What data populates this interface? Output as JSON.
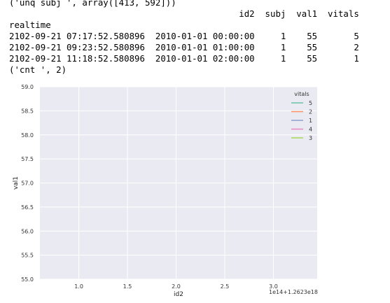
{
  "output": {
    "unq_line": "('unq subj ', array([413, 592]))",
    "table": {
      "index_name": "realtime",
      "columns": [
        "id2",
        "subj",
        "val1",
        "vitals"
      ],
      "rows": [
        {
          "realtime": "2102-09-21 07:17:52.580896",
          "id2": "2010-01-01 00:00:00",
          "subj": "1",
          "val1": "55",
          "vitals": "5"
        },
        {
          "realtime": "2102-09-21 09:23:52.580896",
          "id2": "2010-01-01 01:00:00",
          "subj": "1",
          "val1": "55",
          "vitals": "2"
        },
        {
          "realtime": "2102-09-21 11:18:52.580896",
          "id2": "2010-01-01 02:00:00",
          "subj": "1",
          "val1": "55",
          "vitals": "1"
        }
      ]
    },
    "cnt_line": "('cnt ', 2)"
  },
  "chart_data": {
    "type": "line",
    "xlabel": "id2",
    "ylabel": "val1",
    "x_ticks": [
      "1.0",
      "1.5",
      "2.0",
      "2.5",
      "3.0"
    ],
    "x_offset_label": "1e14+1.2623e18",
    "xlim": [
      0.6,
      3.45
    ],
    "y_ticks": [
      "55.0",
      "55.5",
      "56.0",
      "56.5",
      "57.0",
      "57.5",
      "58.0",
      "58.5",
      "59.0"
    ],
    "ylim": [
      55.0,
      59.0
    ],
    "grid": true,
    "legend": {
      "title": "vitals",
      "placement": "top-right",
      "entries": [
        "5",
        "2",
        "1",
        "4",
        "3"
      ],
      "colors": [
        "#66c2a5",
        "#fc8d62",
        "#8da0cb",
        "#e78ac3",
        "#a6d854"
      ]
    },
    "series": [],
    "background": "#eaeaf2",
    "grid_color": "#ffffff"
  }
}
